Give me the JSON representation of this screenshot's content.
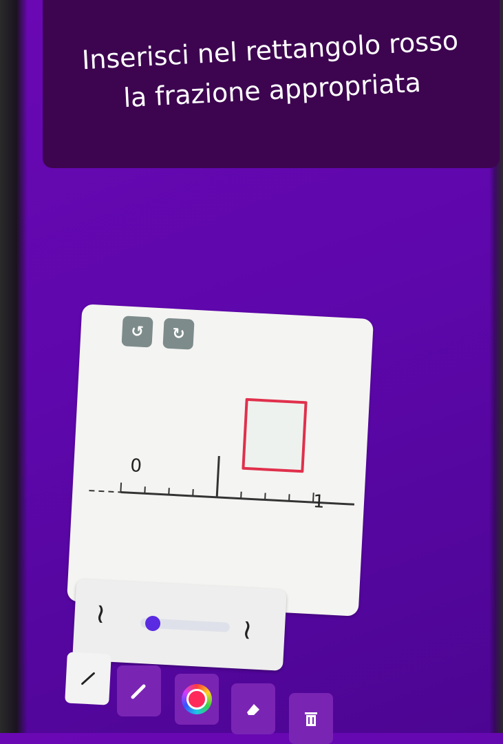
{
  "prompt": {
    "text": "Inserisci nel rettangolo rosso la frazione appropriata"
  },
  "canvas": {
    "undo_icon": "undo-icon",
    "redo_icon": "redo-icon",
    "number_line": {
      "start_label": "0",
      "end_label": "1",
      "divisions": 8,
      "marked_division": 4
    },
    "answer_box_color": "#e0304c"
  },
  "size_panel": {
    "slider_value": 0.05,
    "thin_icon": "thin-stroke-icon",
    "thick_icon": "thick-stroke-icon"
  },
  "toolbar": {
    "tools": [
      "pen-icon",
      "marker-icon",
      "color-picker-icon",
      "eraser-icon",
      "trash-icon"
    ],
    "active_tool": "pen-icon"
  },
  "colors": {
    "background": "#5e07ac",
    "banner": "#3d0550",
    "slider_thumb": "#5a2be0"
  }
}
